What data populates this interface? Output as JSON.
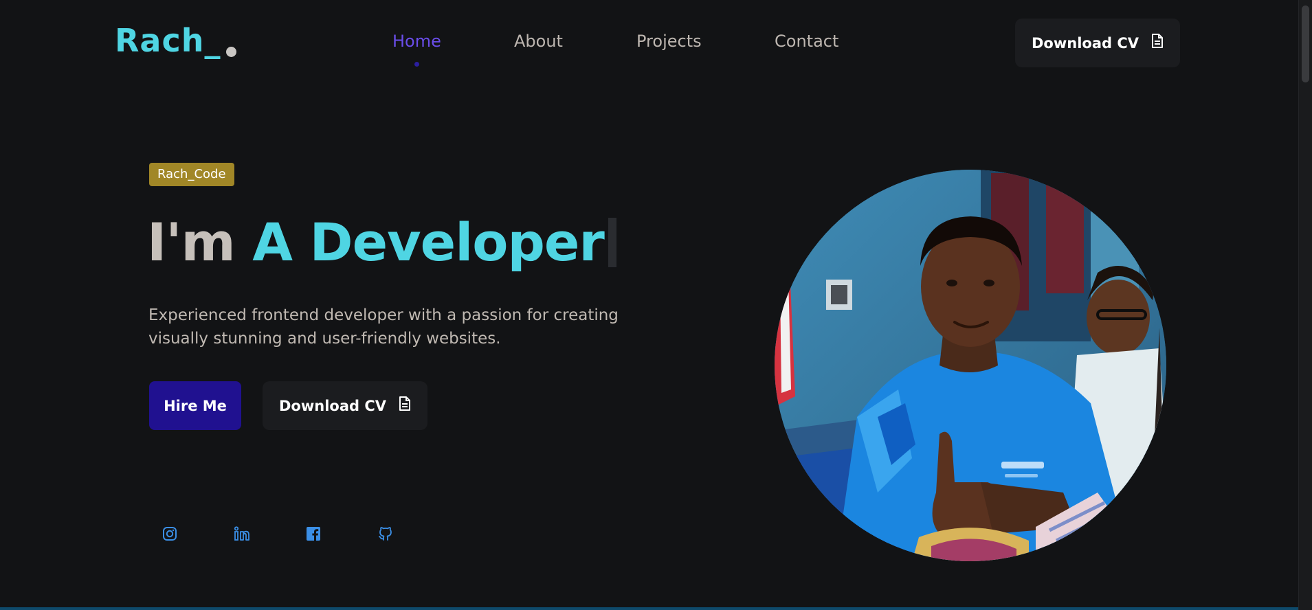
{
  "header": {
    "logo": "Rach_",
    "nav": [
      "Home",
      "About",
      "Projects",
      "Contact"
    ],
    "active_nav": "Home",
    "download_cv": "Download CV"
  },
  "hero": {
    "badge": "Rach_Code",
    "headline_lead": "I'm",
    "headline_role": "A Developer",
    "description": "Experienced frontend developer with a passion for creating visually stunning and user-friendly websites.",
    "hire_button": "Hire Me",
    "download_cv": "Download CV"
  },
  "social": [
    "instagram-icon",
    "linkedin-icon",
    "facebook-icon",
    "github-icon"
  ],
  "colors": {
    "background": "#121315",
    "accent_cyan": "#4fd5e3",
    "accent_purple": "#6a4de9",
    "hire_button": "#201190",
    "badge": "#a18727",
    "social_icon": "#3b8fe6"
  }
}
